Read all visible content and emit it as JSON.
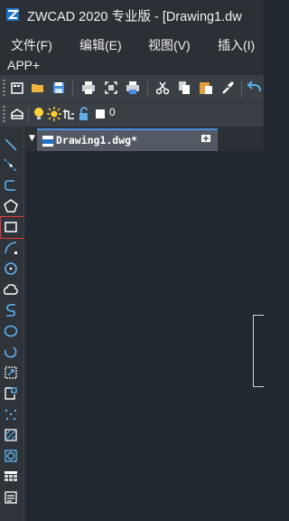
{
  "window": {
    "title": "ZWCAD 2020 专业版 - [Drawing1.dw",
    "app_icon": "zwcad-logo-icon"
  },
  "menu": {
    "items": [
      "文件(F)",
      "编辑(E)",
      "视图(V)",
      "插入(I)",
      "APP+"
    ]
  },
  "toolbar": {
    "icons": [
      "new-file-icon",
      "open-folder-icon",
      "save-icon",
      "print-icon",
      "print-preview-icon",
      "plot-icon",
      "cut-icon",
      "copy-icon",
      "paste-icon",
      "match-properties-icon",
      "undo-icon"
    ]
  },
  "layer_toolbar": {
    "icons": [
      "layer-manager-icon",
      "lightbulb-on-icon",
      "sun-icon",
      "freeze-icon",
      "lock-open-icon",
      "color-swatch-icon"
    ],
    "current_layer": "0"
  },
  "draw_toolbar": {
    "icons": [
      "line-icon",
      "construction-line-icon",
      "polyline-icon",
      "polygon-icon",
      "rectangle-icon",
      "arc-icon",
      "circle-icon",
      "revision-cloud-icon",
      "spline-icon",
      "ellipse-icon",
      "ellipse-arc-icon",
      "insert-block-icon",
      "make-block-icon",
      "point-icon",
      "hatch-icon",
      "region-icon",
      "table-icon",
      "multiline-text-icon"
    ],
    "highlighted": "rectangle-icon"
  },
  "document_tabs": {
    "active_tab": "Drawing1.dwg*",
    "close_symbol": "✕"
  },
  "colors": {
    "background": "#212830",
    "toolbar": "#3a3e45",
    "accent_blue": "#4a90e2",
    "icon_blue": "#5fb1ec",
    "highlight_red": "#e03a3a"
  }
}
